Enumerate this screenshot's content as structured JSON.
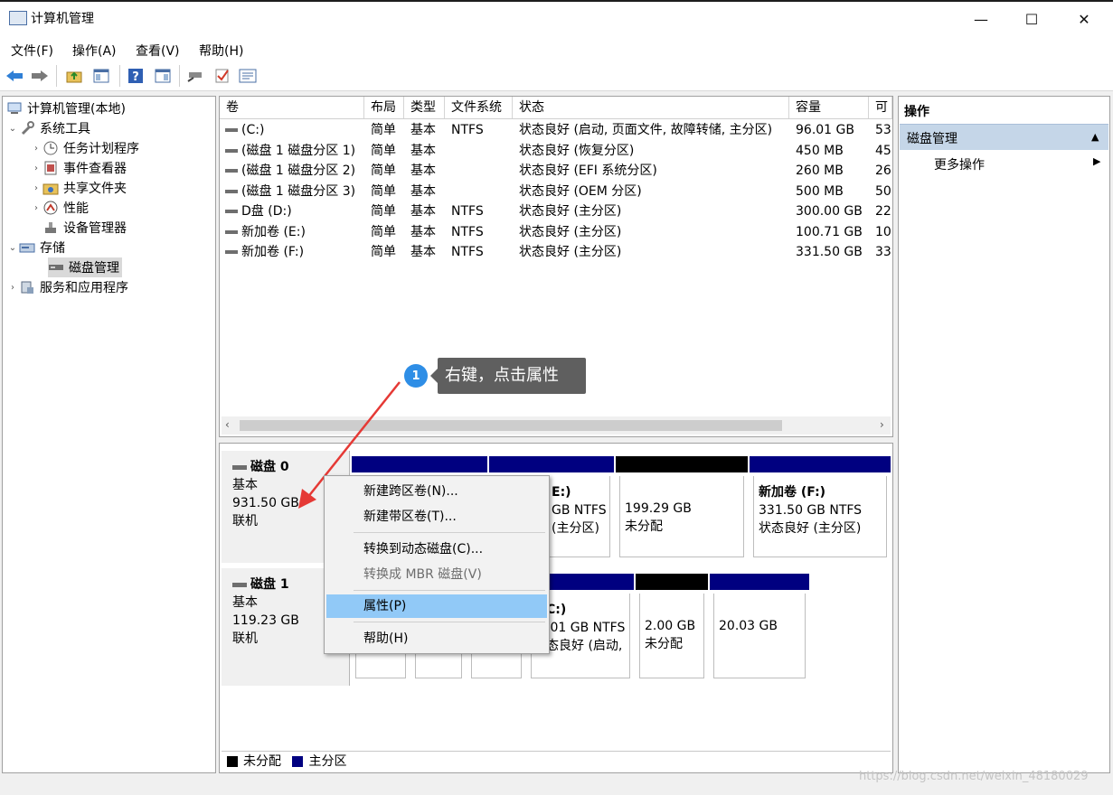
{
  "window": {
    "title": "计算机管理",
    "controls": {
      "minimize": "—",
      "maximize": "☐",
      "close": "✕"
    }
  },
  "menu": [
    "文件(F)",
    "操作(A)",
    "查看(V)",
    "帮助(H)"
  ],
  "tree": {
    "root": "计算机管理(本地)",
    "system_tools": "系统工具",
    "task_scheduler": "任务计划程序",
    "event_viewer": "事件查看器",
    "shared_folders": "共享文件夹",
    "performance": "性能",
    "device_manager": "设备管理器",
    "storage": "存储",
    "disk_management": "磁盘管理",
    "services_apps": "服务和应用程序"
  },
  "volume_list": {
    "columns": [
      "卷",
      "布局",
      "类型",
      "文件系统",
      "状态",
      "容量",
      "可"
    ],
    "rows": [
      [
        "(C:)",
        "简单",
        "基本",
        "NTFS",
        "状态良好 (启动, 页面文件, 故障转储, 主分区)",
        "96.01 GB",
        "53"
      ],
      [
        "(磁盘 1 磁盘分区 1)",
        "简单",
        "基本",
        "",
        "状态良好 (恢复分区)",
        "450 MB",
        "45"
      ],
      [
        "(磁盘 1 磁盘分区 2)",
        "简单",
        "基本",
        "",
        "状态良好 (EFI 系统分区)",
        "260 MB",
        "26"
      ],
      [
        "(磁盘 1 磁盘分区 3)",
        "简单",
        "基本",
        "",
        "状态良好 (OEM 分区)",
        "500 MB",
        "50"
      ],
      [
        "D盘 (D:)",
        "简单",
        "基本",
        "NTFS",
        "状态良好 (主分区)",
        "300.00 GB",
        "22"
      ],
      [
        "新加卷 (E:)",
        "简单",
        "基本",
        "NTFS",
        "状态良好 (主分区)",
        "100.71 GB",
        "10"
      ],
      [
        "新加卷 (F:)",
        "简单",
        "基本",
        "NTFS",
        "状态良好 (主分区)",
        "331.50 GB",
        "33"
      ]
    ]
  },
  "disks": {
    "disk0": {
      "name": "磁盘 0",
      "type": "基本",
      "size": "931.50 GB",
      "status": "联机",
      "part_e_name": "E:)",
      "part_e_size": "GB NTFS",
      "part_e_status": "(主分区)",
      "unalloc_size": "199.29 GB",
      "unalloc_label": "未分配",
      "part_f_name": "新加卷 (F:)",
      "part_f_size": "331.50 GB NTFS",
      "part_f_status": "状态良好 (主分区)"
    },
    "disk1": {
      "name": "磁盘 1",
      "type": "基本",
      "size": "119.23 GB",
      "status": "联机",
      "part_c_name": "C:)",
      "part_c_size": ".01 GB NTFS",
      "part_c_status": "态良好 (启动,",
      "unalloc_size": "2.00 GB",
      "unalloc_label": "未分配",
      "part_last_size": "20.03 GB"
    }
  },
  "legend": {
    "unallocated": "未分配",
    "primary": "主分区"
  },
  "colors": {
    "primary_bar": "#000080",
    "unallocated_bar": "#000000",
    "menu_highlight": "#91c9f7",
    "callout_blue": "#2e8ee6"
  },
  "actions": {
    "header": "操作",
    "section": "磁盘管理",
    "more": "更多操作"
  },
  "context_menu": {
    "new_spanned": "新建跨区卷(N)...",
    "new_striped": "新建带区卷(T)...",
    "to_dynamic": "转换到动态磁盘(C)...",
    "to_mbr": "转换成 MBR 磁盘(V)",
    "properties": "属性(P)",
    "help": "帮助(H)"
  },
  "annotation": {
    "step": "1",
    "text": "右键，点击属性"
  },
  "watermark": "https://blog.csdn.net/weixin_48180029"
}
